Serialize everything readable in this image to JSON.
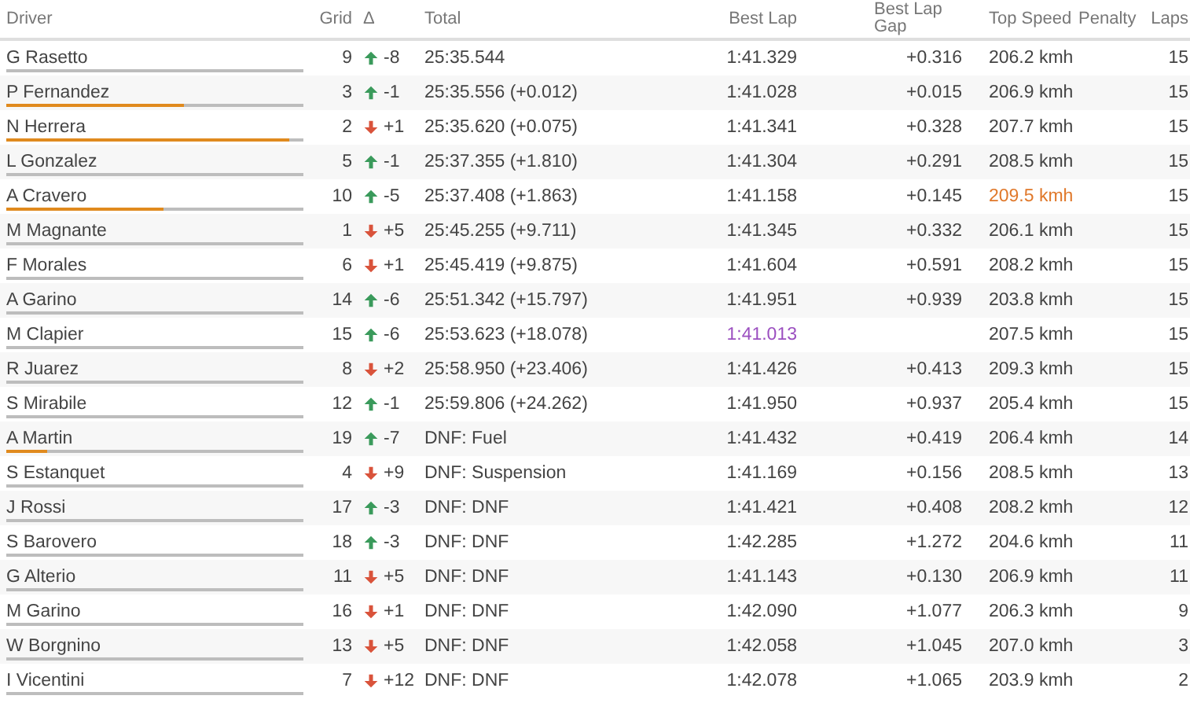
{
  "columns": {
    "driver": "Driver",
    "grid": "Grid",
    "delta": "Δ",
    "total": "Total",
    "best_lap": "Best Lap",
    "best_lap_gap": "Best Lap Gap",
    "top_speed": "Top Speed",
    "penalty": "Penalty",
    "laps": "Laps"
  },
  "rows": [
    {
      "driver": "G Rasetto",
      "grid": "9",
      "kind": "up",
      "delta": "-8",
      "total": "25:35.544",
      "best_lap": "1:41.329",
      "best_lap_overall": false,
      "gap": "+0.316",
      "top_speed": "206.2 kmh",
      "top_speed_overall": false,
      "laps": "15"
    },
    {
      "driver": "P Fernandez",
      "level": 0.6,
      "grid": "3",
      "kind": "up",
      "delta": "-1",
      "total": "25:35.556 (+0.012)",
      "best_lap": "1:41.028",
      "best_lap_overall": false,
      "gap": "+0.015",
      "top_speed": "206.9 kmh",
      "top_speed_overall": false,
      "laps": "15"
    },
    {
      "driver": "N Herrera",
      "level": 0.95,
      "grid": "2",
      "kind": "down",
      "delta": "+1",
      "total": "25:35.620 (+0.075)",
      "best_lap": "1:41.341",
      "best_lap_overall": false,
      "gap": "+0.328",
      "top_speed": "207.7 kmh",
      "top_speed_overall": false,
      "laps": "15"
    },
    {
      "driver": "L Gonzalez",
      "grid": "5",
      "kind": "up",
      "delta": "-1",
      "total": "25:37.355 (+1.810)",
      "best_lap": "1:41.304",
      "best_lap_overall": false,
      "gap": "+0.291",
      "top_speed": "208.5 kmh",
      "top_speed_overall": false,
      "laps": "15"
    },
    {
      "driver": "A Cravero",
      "level": 0.53,
      "grid": "10",
      "kind": "up",
      "delta": "-5",
      "total": "25:37.408 (+1.863)",
      "best_lap": "1:41.158",
      "best_lap_overall": false,
      "gap": "+0.145",
      "top_speed": "209.5 kmh",
      "top_speed_overall": true,
      "laps": "15"
    },
    {
      "driver": "M Magnante",
      "grid": "1",
      "kind": "down",
      "delta": "+5",
      "total": "25:45.255 (+9.711)",
      "best_lap": "1:41.345",
      "best_lap_overall": false,
      "gap": "+0.332",
      "top_speed": "206.1 kmh",
      "top_speed_overall": false,
      "laps": "15"
    },
    {
      "driver": "F Morales",
      "grid": "6",
      "kind": "down",
      "delta": "+1",
      "total": "25:45.419 (+9.875)",
      "best_lap": "1:41.604",
      "best_lap_overall": false,
      "gap": "+0.591",
      "top_speed": "208.2 kmh",
      "top_speed_overall": false,
      "laps": "15"
    },
    {
      "driver": "A Garino",
      "grid": "14",
      "kind": "up",
      "delta": "-6",
      "total": "25:51.342 (+15.797)",
      "best_lap": "1:41.951",
      "best_lap_overall": false,
      "gap": "+0.939",
      "top_speed": "203.8 kmh",
      "top_speed_overall": false,
      "laps": "15"
    },
    {
      "driver": "M Clapier",
      "grid": "15",
      "kind": "up",
      "delta": "-6",
      "total": "25:53.623 (+18.078)",
      "best_lap": "1:41.013",
      "best_lap_overall": true,
      "top_speed": "207.5 kmh",
      "top_speed_overall": false,
      "laps": "15"
    },
    {
      "driver": "R Juarez",
      "grid": "8",
      "kind": "down",
      "delta": "+2",
      "total": "25:58.950 (+23.406)",
      "best_lap": "1:41.426",
      "best_lap_overall": false,
      "gap": "+0.413",
      "top_speed": "209.3 kmh",
      "top_speed_overall": false,
      "laps": "15"
    },
    {
      "driver": "S Mirabile",
      "grid": "12",
      "kind": "up",
      "delta": "-1",
      "total": "25:59.806 (+24.262)",
      "best_lap": "1:41.950",
      "best_lap_overall": false,
      "gap": "+0.937",
      "top_speed": "205.4 kmh",
      "top_speed_overall": false,
      "laps": "15"
    },
    {
      "driver": "A Martin",
      "level": 0.14,
      "grid": "19",
      "kind": "up",
      "delta": "-7",
      "total": "DNF: Fuel",
      "best_lap": "1:41.432",
      "best_lap_overall": false,
      "gap": "+0.419",
      "top_speed": "206.4 kmh",
      "top_speed_overall": false,
      "laps": "14"
    },
    {
      "driver": "S Estanquet",
      "grid": "4",
      "kind": "down",
      "delta": "+9",
      "total": "DNF: Suspension",
      "best_lap": "1:41.169",
      "best_lap_overall": false,
      "gap": "+0.156",
      "top_speed": "208.5 kmh",
      "top_speed_overall": false,
      "laps": "13"
    },
    {
      "driver": "J Rossi",
      "grid": "17",
      "kind": "up",
      "delta": "-3",
      "total": "DNF: DNF",
      "best_lap": "1:41.421",
      "best_lap_overall": false,
      "gap": "+0.408",
      "top_speed": "208.2 kmh",
      "top_speed_overall": false,
      "laps": "12"
    },
    {
      "driver": "S Barovero",
      "grid": "18",
      "kind": "up",
      "delta": "-3",
      "total": "DNF: DNF",
      "best_lap": "1:42.285",
      "best_lap_overall": false,
      "gap": "+1.272",
      "top_speed": "204.6 kmh",
      "top_speed_overall": false,
      "laps": "11"
    },
    {
      "driver": "G Alterio",
      "grid": "11",
      "kind": "down",
      "delta": "+5",
      "total": "DNF: DNF",
      "best_lap": "1:41.143",
      "best_lap_overall": false,
      "gap": "+0.130",
      "top_speed": "206.9 kmh",
      "top_speed_overall": false,
      "laps": "11"
    },
    {
      "driver": "M Garino",
      "grid": "16",
      "kind": "down",
      "delta": "+1",
      "total": "DNF: DNF",
      "best_lap": "1:42.090",
      "best_lap_overall": false,
      "gap": "+1.077",
      "top_speed": "206.3 kmh",
      "top_speed_overall": false,
      "laps": "9"
    },
    {
      "driver": "W Borgnino",
      "grid": "13",
      "kind": "down",
      "delta": "+5",
      "total": "DNF: DNF",
      "best_lap": "1:42.058",
      "best_lap_overall": false,
      "gap": "+1.045",
      "top_speed": "207.0 kmh",
      "top_speed_overall": false,
      "laps": "3"
    },
    {
      "driver": "I Vicentini",
      "grid": "7",
      "kind": "down",
      "delta": "+12",
      "total": "DNF: DNF",
      "best_lap": "1:42.078",
      "best_lap_overall": false,
      "gap": "+1.065",
      "top_speed": "203.9 kmh",
      "top_speed_overall": false,
      "laps": "2"
    }
  ]
}
